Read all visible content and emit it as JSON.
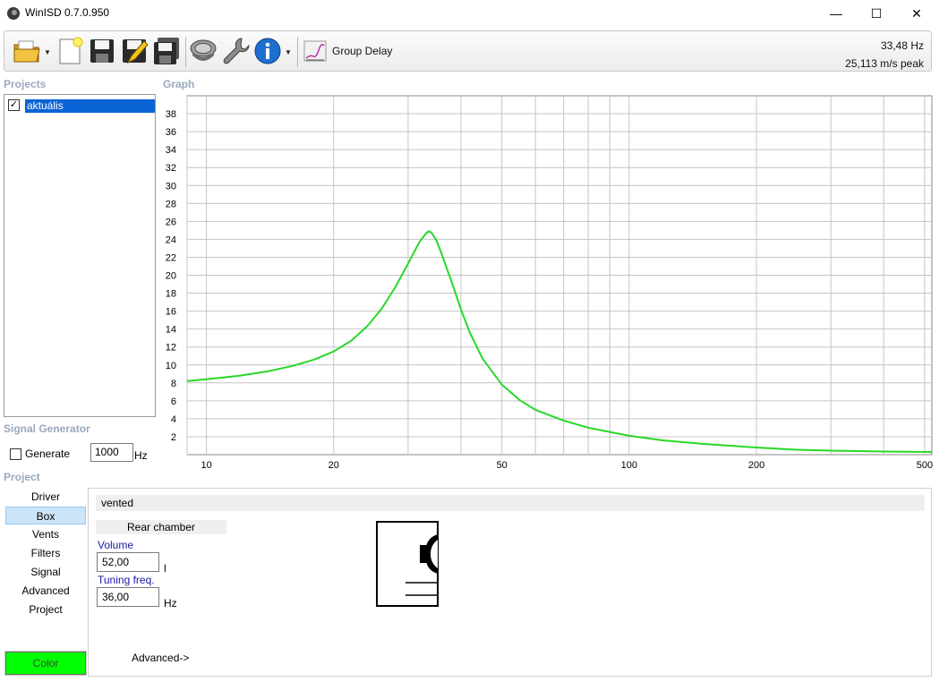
{
  "window": {
    "title": "WinISD 0.7.0.950",
    "controls": {
      "minimize": "—",
      "maximize": "☐",
      "close": "✕"
    }
  },
  "toolbar": {
    "buttons": [
      "open-folder-icon",
      "new-project-icon",
      "save-icon",
      "save-as-icon",
      "save-all-icon",
      "driver-icon",
      "tools-wrench-icon",
      "info-icon"
    ],
    "group_delay_label": "Group Delay",
    "readout_frequency": "33,48 Hz",
    "readout_value": "25,113 m/s peak"
  },
  "projects": {
    "label": "Projects",
    "items": [
      {
        "name": "aktuális",
        "checked": true
      }
    ]
  },
  "graph": {
    "label": "Graph"
  },
  "chart_data": {
    "type": "line",
    "x_scale": "log",
    "xlim": [
      9,
      520
    ],
    "ylim": [
      0,
      40
    ],
    "x_ticks": [
      "10",
      "20",
      "50",
      "100",
      "200",
      "500"
    ],
    "x_tick_values": [
      10,
      20,
      50,
      100,
      200,
      500
    ],
    "y_ticks": [
      "2",
      "4",
      "6",
      "8",
      "10",
      "12",
      "14",
      "16",
      "18",
      "20",
      "22",
      "24",
      "26",
      "28",
      "30",
      "32",
      "34",
      "36",
      "38"
    ],
    "y_tick_values": [
      2,
      4,
      6,
      8,
      10,
      12,
      14,
      16,
      18,
      20,
      22,
      24,
      26,
      28,
      30,
      32,
      34,
      36,
      38
    ],
    "grid": true,
    "series": [
      {
        "color": "#27d827",
        "x": [
          9,
          10,
          12,
          14,
          16,
          18,
          20,
          22,
          24,
          26,
          28,
          30,
          31,
          32,
          33,
          33.5,
          34,
          35,
          36,
          38,
          40,
          42,
          45,
          50,
          55,
          60,
          70,
          80,
          100,
          120,
          150,
          200,
          250,
          300,
          400,
          520
        ],
        "y": [
          8.2,
          8.4,
          8.8,
          9.3,
          9.9,
          10.6,
          11.5,
          12.7,
          14.3,
          16.3,
          18.7,
          21.3,
          22.6,
          23.8,
          24.6,
          24.9,
          24.8,
          23.9,
          22.4,
          19.3,
          16.2,
          13.6,
          10.7,
          7.8,
          6.1,
          5.0,
          3.8,
          3.0,
          2.1,
          1.6,
          1.2,
          0.8,
          0.55,
          0.45,
          0.35,
          0.3
        ]
      }
    ]
  },
  "signal_generator": {
    "label": "Signal Generator",
    "generate_label": "Generate",
    "frequency": "1000",
    "unit": "Hz"
  },
  "project": {
    "label": "Project",
    "nav": [
      "Driver",
      "Box",
      "Vents",
      "Filters",
      "Signal",
      "Advanced",
      "Project"
    ],
    "active": "Box",
    "color_button": "Color",
    "color_value": "#00ff00"
  },
  "box": {
    "type": "vented",
    "chamber_label": "Rear chamber",
    "volume_label": "Volume",
    "volume_value": "52,00",
    "volume_unit": "l",
    "tuning_label": "Tuning freq.",
    "tuning_value": "36,00",
    "tuning_unit": "Hz",
    "advanced_link": "Advanced->"
  }
}
